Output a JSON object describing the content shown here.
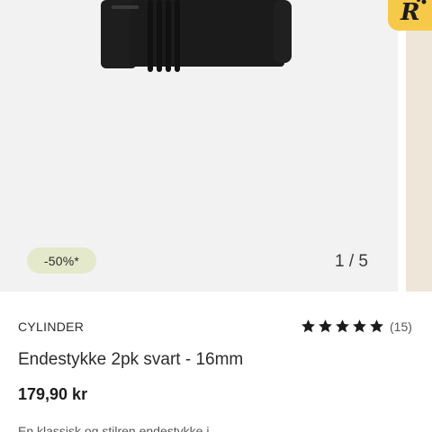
{
  "gallery": {
    "badge": "-50%*",
    "counter": "1 / 5"
  },
  "product": {
    "brand": "CYLINDER",
    "title": "Endestykke 2pk svart - 16mm",
    "price": "179,90 kr",
    "rating": {
      "stars": 5,
      "count": "(15)"
    },
    "description_partial": "En klassisk og stilren endestykke i"
  },
  "icons": {
    "star": "star-icon",
    "logo": "app-logo-icon"
  },
  "colors": {
    "badge_bg": "#e4e9cc",
    "logo_bg": "#f7c948",
    "product_black": "#1a1a1a"
  }
}
